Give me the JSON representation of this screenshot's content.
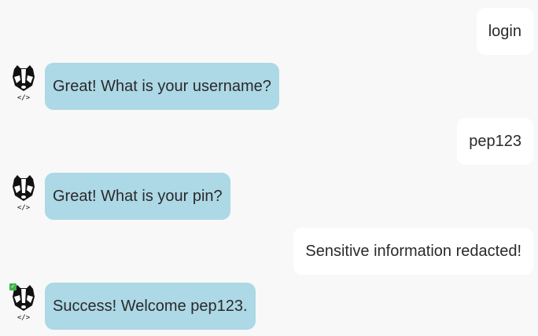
{
  "messages": [
    {
      "role": "user",
      "text": "login"
    },
    {
      "role": "bot",
      "text": "Great! What is your username?"
    },
    {
      "role": "user",
      "text": "pep123"
    },
    {
      "role": "bot",
      "text": "Great! What is your pin?"
    },
    {
      "role": "user",
      "text": "Sensitive information redacted!"
    },
    {
      "role": "bot",
      "text": "Success! Welcome pep123.",
      "verified": true
    }
  ],
  "icons": {
    "avatar": "badger-avatar-icon",
    "verified": "verified-check-icon",
    "verified_color": "#3cb54a"
  },
  "colors": {
    "background": "#f8f8f8",
    "user_bubble": "#ffffff",
    "bot_bubble": "#add8e6",
    "text": "#2a2a2a"
  }
}
